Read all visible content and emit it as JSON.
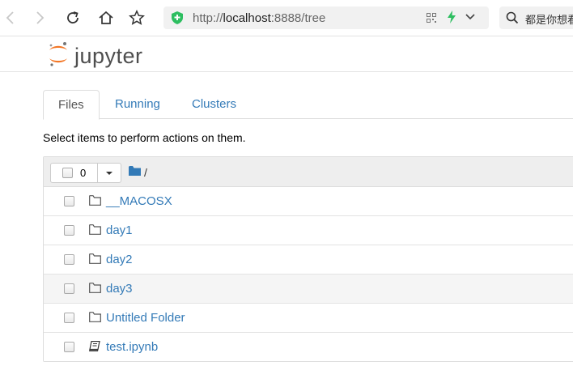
{
  "browser": {
    "url_prefix": "http://",
    "url_host": "localhost",
    "url_rest": ":8888/tree",
    "search_placeholder": "都是你想看"
  },
  "header": {
    "logo_text": "jupyter"
  },
  "tabs": [
    {
      "label": "Files",
      "active": true
    },
    {
      "label": "Running",
      "active": false
    },
    {
      "label": "Clusters",
      "active": false
    }
  ],
  "hint": "Select items to perform actions on them.",
  "list": {
    "selected_count": "0",
    "breadcrumb": "/",
    "items": [
      {
        "name": "__MACOSX",
        "type": "folder"
      },
      {
        "name": "day1",
        "type": "folder"
      },
      {
        "name": "day2",
        "type": "folder"
      },
      {
        "name": "day3",
        "type": "folder"
      },
      {
        "name": "Untitled Folder",
        "type": "folder"
      },
      {
        "name": "test.ipynb",
        "type": "notebook"
      }
    ]
  },
  "colors": {
    "link": "#337ab7",
    "jupyter_orange": "#f37726",
    "shield_green": "#2dbe60",
    "folder_blue": "#337ab7"
  }
}
